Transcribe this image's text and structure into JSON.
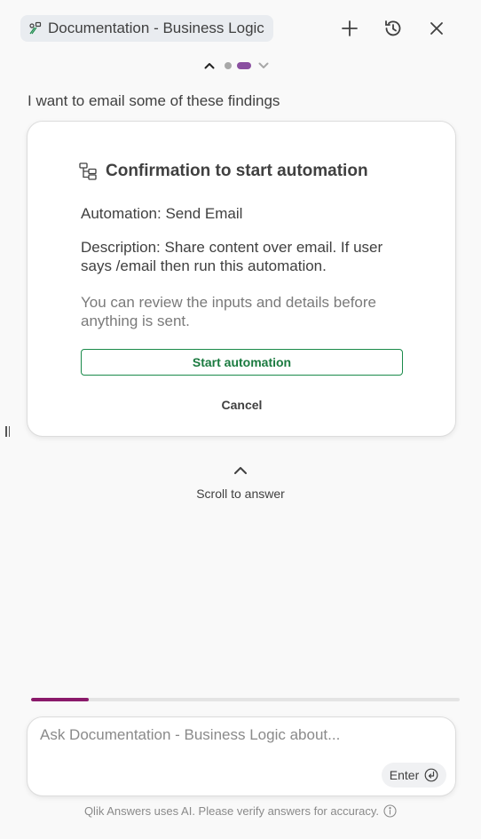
{
  "header": {
    "assistant_name": "Documentation - Business Logic",
    "assistant_icon": "assistant-icon",
    "new_icon": "plus-icon",
    "history_icon": "history-icon",
    "close_icon": "close-icon"
  },
  "pager": {
    "up_icon": "chevron-up-icon",
    "down_icon": "chevron-down-icon",
    "active_color": "#8a4fa0"
  },
  "question": "I want to email some of these findings",
  "card": {
    "title": "Confirmation to start automation",
    "title_icon": "automation-icon",
    "automation": "Automation: Send Email",
    "description": "Description: Share content over email. If user says /email then run this automation.",
    "note": "You can review the inputs and details before anything is sent.",
    "start_label": "Start automation",
    "cancel_label": "Cancel",
    "accent_color": "#1a8a4a"
  },
  "scroll": {
    "label": "Scroll to answer",
    "icon": "chevron-up-icon"
  },
  "progress": {
    "fraction": 0.135,
    "color": "#8a1a6a"
  },
  "input": {
    "placeholder": "Ask Documentation - Business Logic about...",
    "value": "",
    "enter_label": "Enter",
    "enter_icon": "enter-icon"
  },
  "disclaimer": {
    "text": "Qlik Answers uses AI. Please verify answers for accuracy.",
    "icon": "info-icon"
  }
}
